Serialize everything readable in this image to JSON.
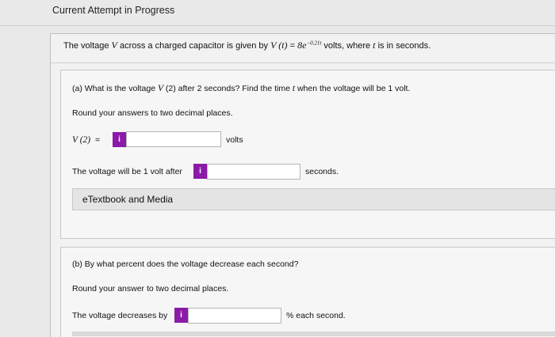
{
  "header": {
    "title": "Current Attempt in Progress"
  },
  "intro": {
    "pre": "The voltage ",
    "var_v": "V",
    "mid": " across a charged capacitor is given by ",
    "func": "V (t)",
    "eq": " = ",
    "base": "8e",
    "exponent": "−0.21t",
    "post": " volts, where ",
    "var_t": "t",
    "post2": " is in seconds."
  },
  "partA": {
    "question_pre": "(a) What is the voltage ",
    "question_var": "V",
    "question_mid": " (2) after 2 seconds? Find the time ",
    "question_var2": "t",
    "question_post": " when the voltage will be 1 volt.",
    "instruction": "Round your answers to two decimal places.",
    "v2_label": "V (2)",
    "v2_eq": "=",
    "info_glyph": "i",
    "v2_unit": "volts",
    "v2_value": "",
    "time_label": "The voltage will be 1 volt after",
    "time_unit": "seconds.",
    "time_value": ""
  },
  "etextbook": {
    "label": "eTextbook and Media"
  },
  "partB": {
    "question": "(b) By what percent does the voltage decrease each second?",
    "instruction": "Round your answer to two decimal places.",
    "label": "The voltage decreases by",
    "info_glyph": "i",
    "unit": "% each second.",
    "value": ""
  },
  "colors": {
    "info_button": "#8b1aa8",
    "panel": "#f2f2f2"
  }
}
